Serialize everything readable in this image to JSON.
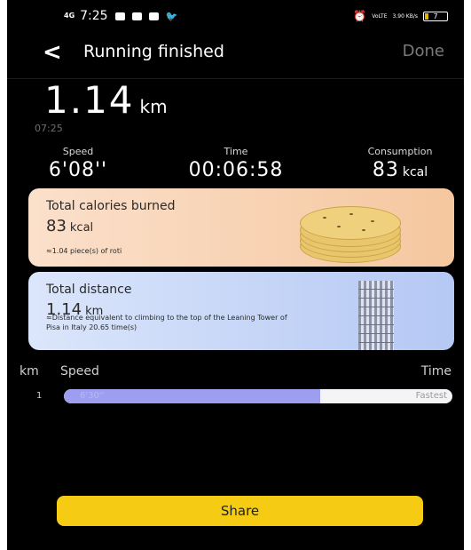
{
  "status_bar": {
    "network": "4G",
    "time": "7:25",
    "right_small": "3.90\nKB/s",
    "volte": "VoLTE",
    "battery": "7"
  },
  "header": {
    "back_icon": "chevron-left-icon",
    "title": "Running finished",
    "done_label": "Done"
  },
  "summary": {
    "distance": "1.14",
    "distance_unit": "km",
    "time_of_day": "07:25"
  },
  "stats": [
    {
      "label": "Speed",
      "value": "6'08''",
      "unit": ""
    },
    {
      "label": "Time",
      "value": "00:06:58",
      "unit": ""
    },
    {
      "label": "Consumption",
      "value": "83",
      "unit": "kcal"
    }
  ],
  "calories_card": {
    "heading": "Total calories burned",
    "value": "83",
    "unit": "kcal",
    "note": "≈1.04 piece(s) of roti",
    "illustration": "roti-stack"
  },
  "distance_card": {
    "heading": "Total distance",
    "value": "1.14",
    "unit": "km",
    "note": "≈Distance equivalent to climbing to the top of the Leaning Tower of Pisa in Italy 20.65 time(s)",
    "illustration": "leaning-tower-of-pisa"
  },
  "splits": {
    "col_km": "km",
    "col_speed": "Speed",
    "col_time": "Time",
    "rows": [
      {
        "km": "1",
        "pace": "6'30''",
        "badge": "Fastest",
        "fill_fraction": 0.66
      }
    ]
  },
  "share_label": "Share",
  "colors": {
    "accent": "#f5cc13",
    "bar_fill": "#9e9ef0",
    "calorie_card": "#f5c79f",
    "distance_card": "#b5c8f4"
  }
}
